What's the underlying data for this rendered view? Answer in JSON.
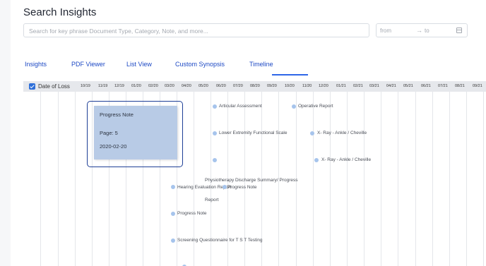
{
  "page": {
    "title": "Search Insights"
  },
  "search": {
    "placeholder": "Search for key phrase Document Type, Category, Note, and more...",
    "value": ""
  },
  "date_range": {
    "from_placeholder": "from",
    "arrow": "→",
    "to_placeholder": "to",
    "icon": "calendar-icon"
  },
  "tabs": [
    {
      "label": "Insights",
      "active": false
    },
    {
      "label": "PDF Viewer",
      "active": false
    },
    {
      "label": "List View",
      "active": false
    },
    {
      "label": "Custom Synopsis",
      "active": false
    },
    {
      "label": "Timeline",
      "active": true
    }
  ],
  "timeline": {
    "filter": {
      "label": "Date of Loss",
      "checked": true
    },
    "months": [
      "10/19",
      "11/19",
      "12/19",
      "01/20",
      "02/20",
      "03/20",
      "04/20",
      "05/20",
      "06/20",
      "07/20",
      "08/20",
      "09/20",
      "10/20",
      "11/20",
      "12/20",
      "01/21",
      "02/21",
      "03/21",
      "04/21",
      "05/21",
      "06/21",
      "07/21",
      "08/21",
      "09/21"
    ],
    "events": [
      {
        "label": "Articular Assessment"
      },
      {
        "label": "Operative Report"
      },
      {
        "label": "Lower Extremity Functional Scale"
      },
      {
        "label": "X- Ray - Ankle / Cheville"
      },
      {
        "label": "X- Ray - Ankle / Cheville"
      },
      {
        "label": "Physiotherapy Discharge Summary/ Progress"
      },
      {
        "label": "Hearing Evaluation Report"
      },
      {
        "label": "Progress Note"
      },
      {
        "label": "Report"
      },
      {
        "label": "Progress Note"
      },
      {
        "label": "Screening Questionnaire for T S T Testing"
      }
    ],
    "tooltip": {
      "title": "Progress Note",
      "page": "Page: 5",
      "date": "2020-02-20"
    },
    "colors": {
      "dot": "#a6c4ec",
      "tooltip_bg": "#b8cbe6",
      "focus_ring": "#1e3f96",
      "accent": "#2e66e8"
    }
  }
}
